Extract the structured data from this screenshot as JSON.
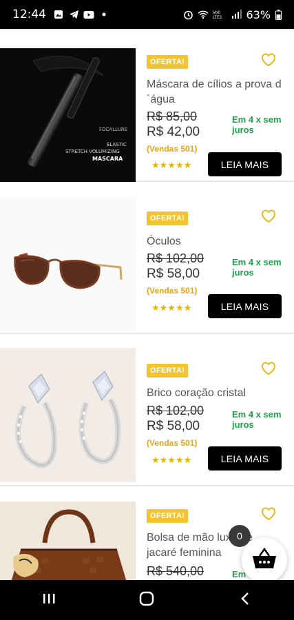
{
  "status_bar": {
    "time": "12:44",
    "battery": "63%",
    "icons": [
      "gallery-icon",
      "telegram-icon",
      "youtube-icon",
      "dot-icon",
      "alarm-icon",
      "wifi-icon",
      "volte-icon",
      "signal-icon",
      "battery-icon"
    ]
  },
  "products": [
    {
      "badge": "OFERTA!",
      "name": "Máscara de cílios a prova d´água",
      "old_price": "R$ 85,00",
      "new_price": "R$ 42,00",
      "sales": "(Vendas 501)",
      "installments": "Em 4 x sem juros",
      "stars": "★★★★★",
      "button": "LEIA MAIS",
      "image_text": {
        "brand": "FOCALLURE",
        "line1": "ELASTIC",
        "line2": "STRETCH VOLUMIZING",
        "line3": "MASCARA"
      }
    },
    {
      "badge": "OFERTA!",
      "name": "Óculos",
      "old_price": "R$ 102,00",
      "new_price": "R$ 58,00",
      "sales": "(Vendas 501)",
      "installments": "Em 4 x sem juros",
      "stars": "★★★★★",
      "button": "LEIA MAIS"
    },
    {
      "badge": "OFERTA!",
      "name": "Brico coração cristal",
      "old_price": "R$ 102,00",
      "new_price": "R$ 58,00",
      "sales": "(Vendas 501)",
      "installments": "Em 4 x sem juros",
      "stars": "★★★★★",
      "button": "LEIA MAIS"
    },
    {
      "badge": "OFERTA!",
      "name": "Bolsa de mão luxo de jacaré feminina",
      "old_price": "R$ 540,00",
      "installments": "Em"
    }
  ],
  "cart": {
    "count": "0"
  },
  "colors": {
    "badge": "#f4c430",
    "installments": "#1fa34a",
    "sales": "#e8a317",
    "button": "#000000"
  }
}
